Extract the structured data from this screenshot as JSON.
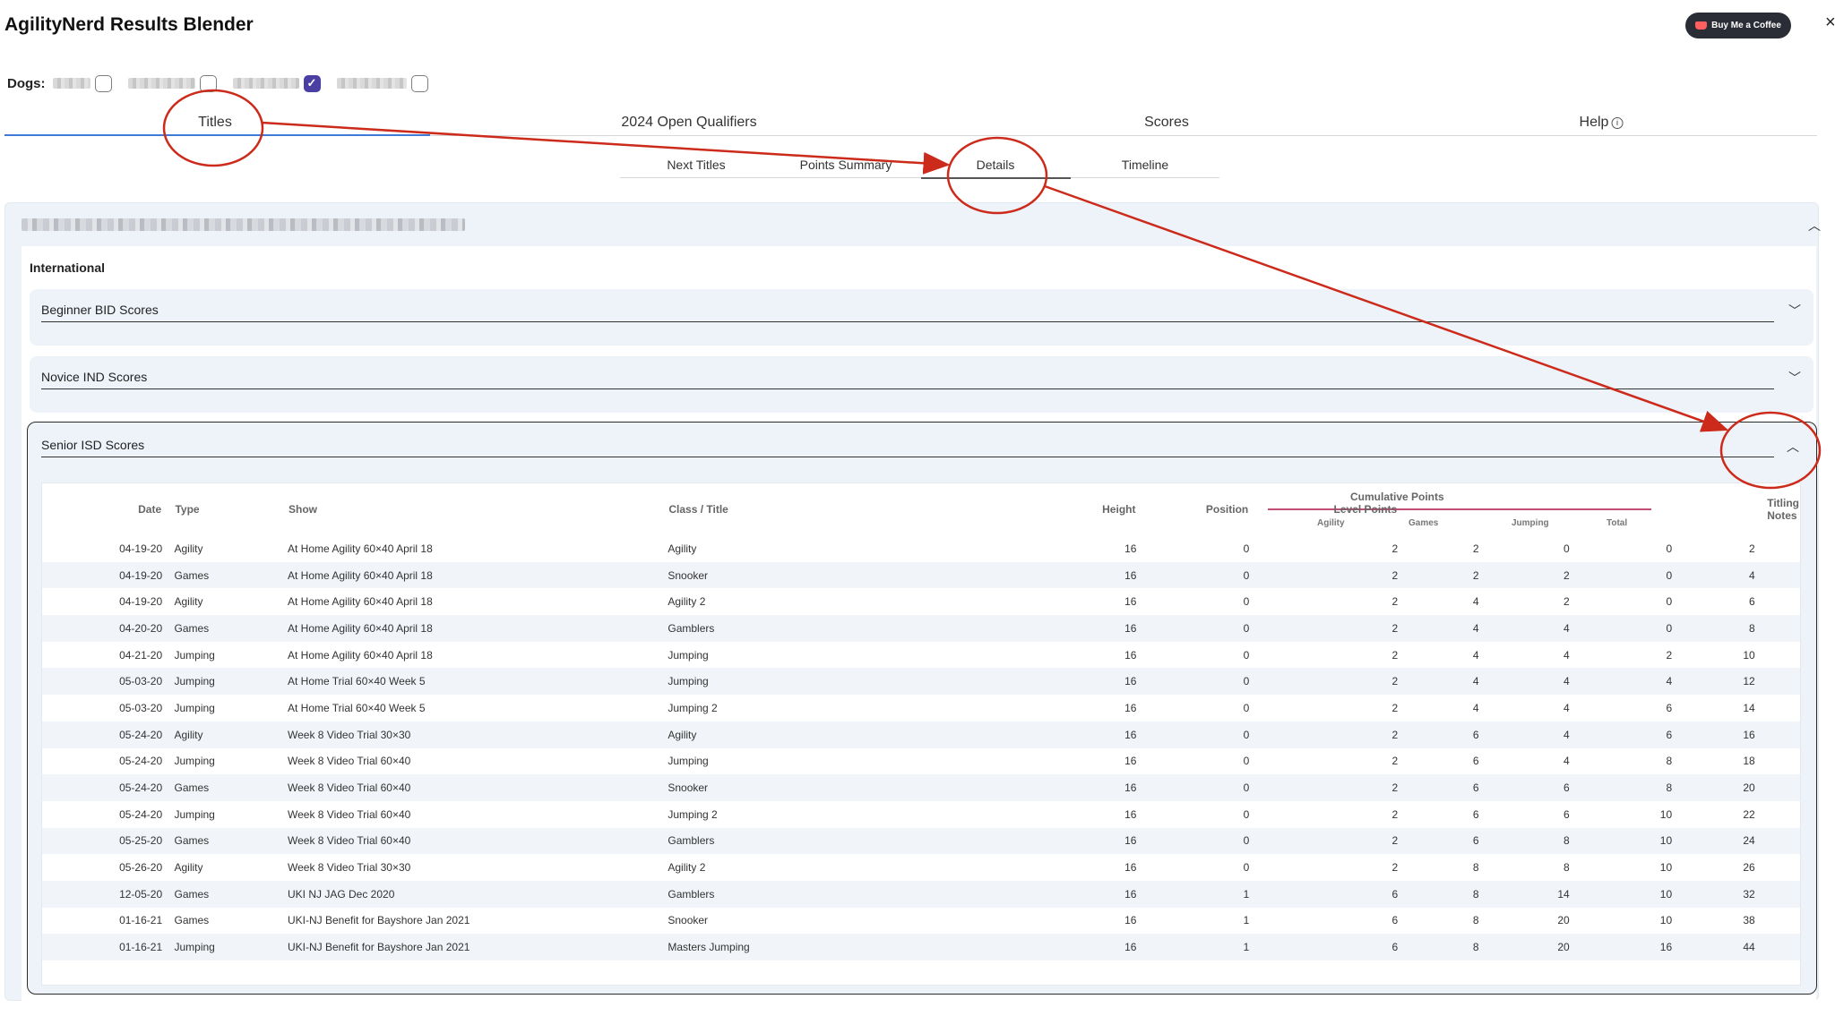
{
  "app": {
    "title": "AgilityNerd Results Blender",
    "coffee_label": "Buy Me a Coffee",
    "close_symbol": "×"
  },
  "dogs": {
    "label": "Dogs:",
    "items": [
      {
        "checked": false
      },
      {
        "checked": false
      },
      {
        "checked": true
      },
      {
        "checked": false
      }
    ]
  },
  "tabs": [
    {
      "label": "Titles",
      "active": true
    },
    {
      "label": "2024 Open Qualifiers"
    },
    {
      "label": "Scores"
    },
    {
      "label": "Help"
    }
  ],
  "subtabs": [
    {
      "label": "Next Titles"
    },
    {
      "label": "Points Summary"
    },
    {
      "label": "Details",
      "active": true
    },
    {
      "label": "Timeline"
    }
  ],
  "organization": "International",
  "sections": [
    {
      "title": "Beginner BID Scores",
      "open": false
    },
    {
      "title": "Novice IND Scores",
      "open": false
    },
    {
      "title": "Senior ISD Scores",
      "open": true
    }
  ],
  "table": {
    "headers": {
      "date": "Date",
      "type": "Type",
      "show": "Show",
      "class": "Class / Title",
      "height": "Height",
      "position": "Position",
      "level_points": "Level Points",
      "cumulative": "Cumulative Points",
      "agility": "Agility",
      "games": "Games",
      "jumping": "Jumping",
      "total": "Total",
      "notes": "Titling Notes"
    },
    "rows": [
      [
        "04-19-20",
        "Agility",
        "At Home Agility 60×40 April 18",
        "Agility",
        "16",
        "0",
        "2",
        "2",
        "0",
        "0",
        "2"
      ],
      [
        "04-19-20",
        "Games",
        "At Home Agility 60×40 April 18",
        "Snooker",
        "16",
        "0",
        "2",
        "2",
        "2",
        "0",
        "4"
      ],
      [
        "04-19-20",
        "Agility",
        "At Home Agility 60×40 April 18",
        "Agility 2",
        "16",
        "0",
        "2",
        "4",
        "2",
        "0",
        "6"
      ],
      [
        "04-20-20",
        "Games",
        "At Home Agility 60×40 April 18",
        "Gamblers",
        "16",
        "0",
        "2",
        "4",
        "4",
        "0",
        "8"
      ],
      [
        "04-21-20",
        "Jumping",
        "At Home Agility 60×40 April 18",
        "Jumping",
        "16",
        "0",
        "2",
        "4",
        "4",
        "2",
        "10"
      ],
      [
        "05-03-20",
        "Jumping",
        "At Home Trial 60×40 Week 5",
        "Jumping",
        "16",
        "0",
        "2",
        "4",
        "4",
        "4",
        "12"
      ],
      [
        "05-03-20",
        "Jumping",
        "At Home Trial 60×40 Week 5",
        "Jumping 2",
        "16",
        "0",
        "2",
        "4",
        "4",
        "6",
        "14"
      ],
      [
        "05-24-20",
        "Agility",
        "Week 8 Video Trial 30×30",
        "Agility",
        "16",
        "0",
        "2",
        "6",
        "4",
        "6",
        "16"
      ],
      [
        "05-24-20",
        "Jumping",
        "Week 8 Video Trial 60×40",
        "Jumping",
        "16",
        "0",
        "2",
        "6",
        "4",
        "8",
        "18"
      ],
      [
        "05-24-20",
        "Games",
        "Week 8 Video Trial 60×40",
        "Snooker",
        "16",
        "0",
        "2",
        "6",
        "6",
        "8",
        "20"
      ],
      [
        "05-24-20",
        "Jumping",
        "Week 8 Video Trial 60×40",
        "Jumping 2",
        "16",
        "0",
        "2",
        "6",
        "6",
        "10",
        "22"
      ],
      [
        "05-25-20",
        "Games",
        "Week 8 Video Trial 60×40",
        "Gamblers",
        "16",
        "0",
        "2",
        "6",
        "8",
        "10",
        "24"
      ],
      [
        "05-26-20",
        "Agility",
        "Week 8 Video Trial 30×30",
        "Agility 2",
        "16",
        "0",
        "2",
        "8",
        "8",
        "10",
        "26"
      ],
      [
        "12-05-20",
        "Games",
        "UKI NJ JAG Dec 2020",
        "Gamblers",
        "16",
        "1",
        "6",
        "8",
        "14",
        "10",
        "32"
      ],
      [
        "01-16-21",
        "Games",
        "UKI-NJ Benefit for Bayshore Jan 2021",
        "Snooker",
        "16",
        "1",
        "6",
        "8",
        "20",
        "10",
        "38"
      ],
      [
        "01-16-21",
        "Jumping",
        "UKI-NJ Benefit for Bayshore Jan 2021",
        "Masters Jumping",
        "16",
        "1",
        "6",
        "8",
        "20",
        "16",
        "44"
      ]
    ]
  },
  "colors": {
    "accent": "#3e7ad6",
    "checkbox": "#4b3fa3",
    "annotation": "#cc2a1a",
    "cumulative_line": "#c24f73"
  }
}
